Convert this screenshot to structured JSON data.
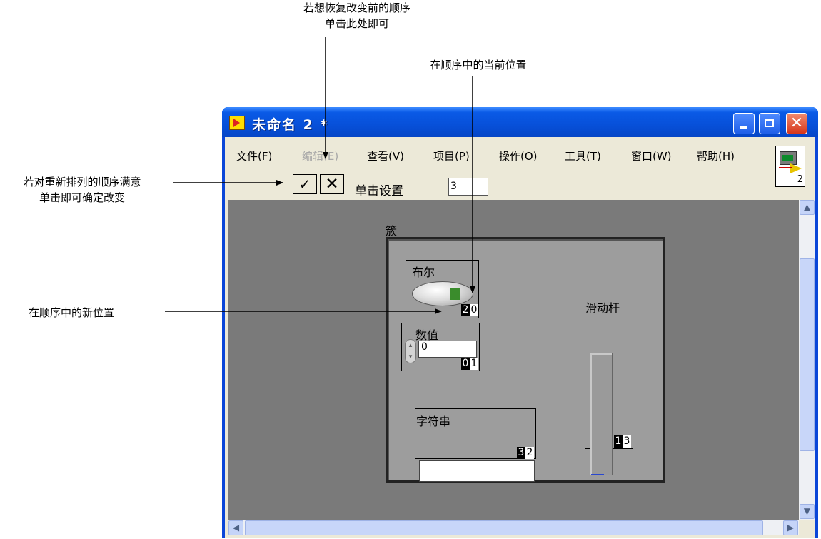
{
  "annotations": {
    "restore_order": [
      "若想恢复改变前的顺序",
      "单击此处即可"
    ],
    "current_position": "在顺序中的当前位置",
    "confirm_change": [
      "若对重新排列的顺序满意",
      "单击即可确定改变"
    ],
    "new_position": "在顺序中的新位置"
  },
  "window": {
    "title": "未命名 2 *",
    "close_glyph": "✕"
  },
  "menu": {
    "items": [
      "文件(F)",
      "编辑(E)",
      "查看(V)",
      "项目(P)",
      "操作(O)",
      "工具(T)",
      "窗口(W)",
      "帮助(H)"
    ],
    "disabled_index": 1
  },
  "vi_icon": {
    "number": "2"
  },
  "toolbar": {
    "ok_glyph": "✓",
    "cancel_glyph": "✕",
    "click_set_label": "单击设置",
    "click_set_value": "3"
  },
  "front_panel": {
    "cluster_label": "簇",
    "boolean": {
      "label": "布尔",
      "order_current": "2",
      "order_new": "0"
    },
    "numeric": {
      "label": "数值",
      "value": "0",
      "order_current": "0",
      "order_new": "1"
    },
    "string": {
      "label": "字符串",
      "value": "",
      "order_current": "3",
      "order_new": "2"
    },
    "slider": {
      "label": "滑动杆",
      "order_current": "1",
      "order_new": "3"
    }
  },
  "scrollbars": {
    "up_glyph": "▲",
    "down_glyph": "▼",
    "left_glyph": "◀",
    "right_glyph": "▶"
  },
  "colors": {
    "title_bar": "#0750d9",
    "panel": "#7a7a7a",
    "cluster": "#9d9d9d",
    "window_chrome": "#ece9d8"
  }
}
